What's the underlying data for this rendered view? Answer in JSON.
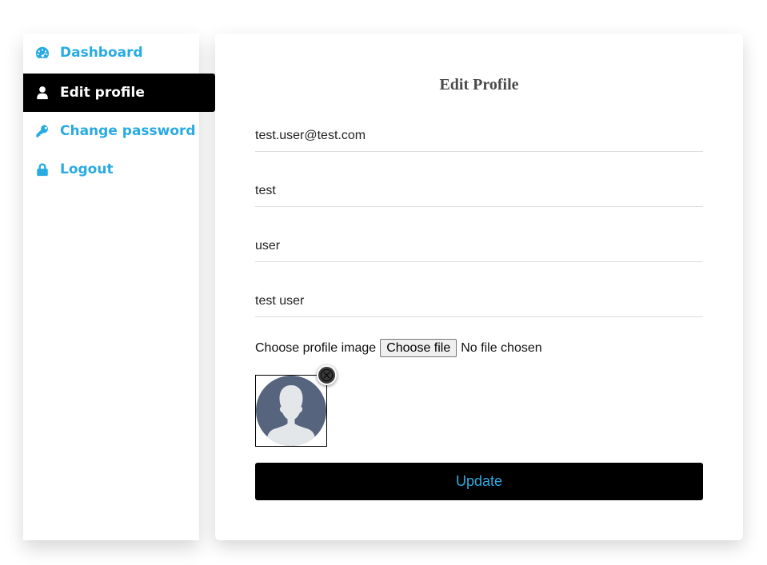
{
  "sidebar": {
    "items": [
      {
        "label": "Dashboard",
        "icon": "dashboard-icon",
        "active": false
      },
      {
        "label": "Edit profile",
        "icon": "user-icon",
        "active": true
      },
      {
        "label": "Change password",
        "icon": "key-icon",
        "active": false
      },
      {
        "label": "Logout",
        "icon": "lock-icon",
        "active": false
      }
    ]
  },
  "form": {
    "title": "Edit Profile",
    "email": "test.user@test.com",
    "first_name": "test",
    "last_name": "user",
    "username": "test user",
    "file_label": "Choose profile image",
    "file_button": "Choose file",
    "file_status": "No file chosen",
    "submit_label": "Update"
  },
  "colors": {
    "accent": "#29abe2",
    "active_bg": "#000000",
    "avatar_bg": "#56647e",
    "avatar_fg": "#e3e7ea"
  }
}
